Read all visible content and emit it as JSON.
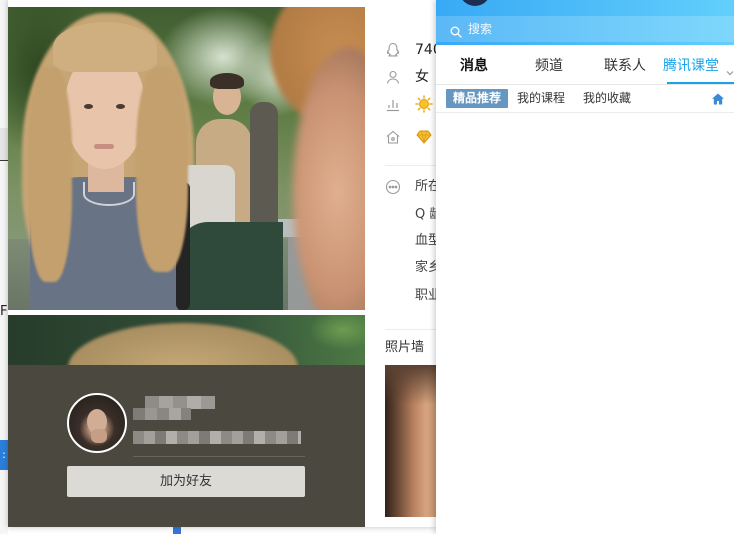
{
  "left_edge": {
    "letter": "F",
    "blue_tab_glyph": ":"
  },
  "profile_card": {
    "add_friend_button": "加为好友",
    "info": {
      "qq_number": "740",
      "gender": "女",
      "location": "所在",
      "q_age": "Q 龄",
      "blood_type": "血型",
      "hometown": "家乡",
      "occupation": "职业"
    },
    "photo_wall_title": "照片墙"
  },
  "qq_panel": {
    "search_placeholder": "搜索",
    "tabs": [
      {
        "label": "消息",
        "active": false
      },
      {
        "label": "频道",
        "active": false
      },
      {
        "label": "联系人",
        "active": false
      },
      {
        "label": "腾讯课堂",
        "active": true
      }
    ],
    "subtabs": [
      {
        "label": "精品推荐",
        "active": true
      },
      {
        "label": "我的课程",
        "active": false
      },
      {
        "label": "我的收藏",
        "active": false
      }
    ]
  },
  "icons": {
    "qq_number": "penguin-icon",
    "gender": "person-icon",
    "level": "chart-icon",
    "level_badge": "sun-icon",
    "vip": "house-icon",
    "vip_badge": "crown-icon",
    "location": "more-dots-icon",
    "search": "search-icon",
    "dropdown": "chevron-down-icon",
    "home": "home-icon"
  },
  "colors": {
    "accent_blue": "#1aa3e8",
    "header_gradient_start": "#38a9f5",
    "header_gradient_end": "#62cffb",
    "subtab_active_bg": "#6597c0",
    "profile_panel_bg": "#4b4840",
    "button_bg": "#dcdad5",
    "level_yellow": "#f6c12b"
  }
}
